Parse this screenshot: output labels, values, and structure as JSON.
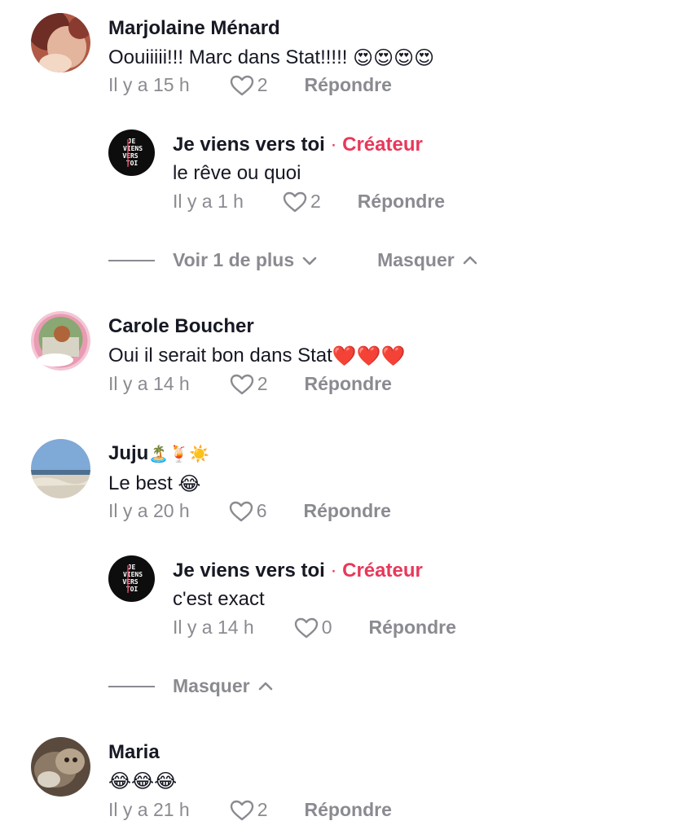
{
  "comments": [
    {
      "author": "Marjolaine Ménard",
      "text": "Oouiiiii!!! Marc dans Stat!!!!!",
      "emoji": "😍😍😍😍",
      "time": "Il y a 15 h",
      "likes": "2",
      "reply_label": "Répondre"
    },
    {
      "author": "Je viens vers toi",
      "creator_sep": "·",
      "creator_label": "Créateur",
      "text": "le rêve ou quoi",
      "time": "Il y a 1 h",
      "likes": "2",
      "reply_label": "Répondre"
    },
    {
      "author": "Carole Boucher",
      "text": "Oui il serait bon dans Stat",
      "emoji": "❤️❤️❤️",
      "time": "Il y a 14 h",
      "likes": "2",
      "reply_label": "Répondre"
    },
    {
      "author": "Juju",
      "author_emoji": "🏝️🍹☀️",
      "text": "Le best",
      "emoji": "😂",
      "time": "Il y a 20 h",
      "likes": "6",
      "reply_label": "Répondre"
    },
    {
      "author": "Je viens vers toi",
      "creator_sep": "·",
      "creator_label": "Créateur",
      "text": "c'est exact",
      "time": "Il y a 14 h",
      "likes": "0",
      "reply_label": "Répondre"
    },
    {
      "author": "Maria",
      "text": "",
      "emoji": "😂😂😂",
      "time": "Il y a 21 h",
      "likes": "2",
      "reply_label": "Répondre"
    }
  ],
  "thread1": {
    "more_label": "Voir 1 de plus",
    "hide_label": "Masquer"
  },
  "thread2": {
    "hide_label": "Masquer"
  },
  "logo_text": "JE VIENS VERS TOI",
  "colors": {
    "creator": "#e8385a",
    "muted": "#8a8b91",
    "text": "#161823"
  }
}
